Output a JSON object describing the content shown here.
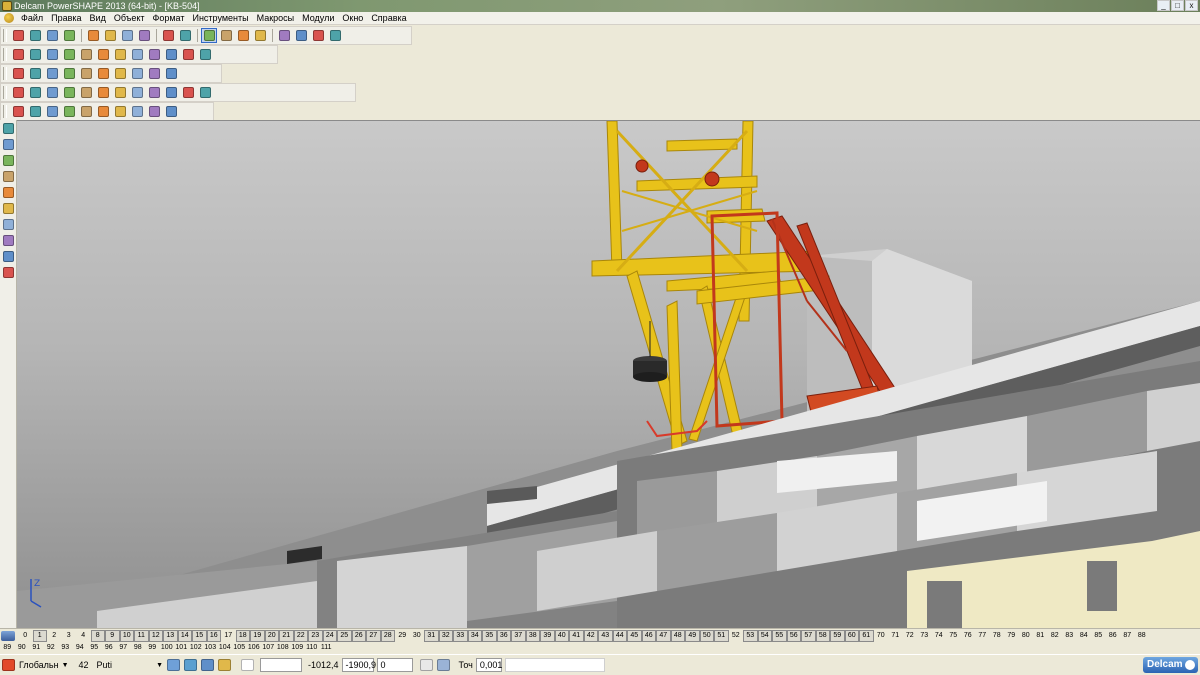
{
  "window": {
    "title": "Delcam PowerSHAPE 2013 (64-bit) - [KB-504]",
    "controls": [
      "_",
      "□",
      "x"
    ]
  },
  "menu": {
    "items": [
      "Файл",
      "Правка",
      "Вид",
      "Объект",
      "Формат",
      "Инструменты",
      "Макросы",
      "Модули",
      "Окно",
      "Справка"
    ]
  },
  "toolbars": {
    "row1_icons": [
      "new-icon",
      "open-icon",
      "save-icon",
      "print-icon",
      "separator",
      "cut-icon",
      "copy-icon",
      "paste-icon",
      "delete-icon",
      "separator",
      "undo-icon",
      "redo-icon",
      "separator",
      "select-icon",
      "circle-icon",
      "arc-icon",
      "text-icon",
      "separator",
      "solid-icon",
      "surface-icon",
      "wireframe-icon",
      "tools-icon"
    ],
    "row2_icons": [
      "view-top-icon",
      "view-front-icon",
      "view-right-icon",
      "view-iso-icon",
      "zoom-in-icon",
      "zoom-out-icon",
      "zoom-box-icon",
      "zoom-all-icon",
      "shade-icon",
      "wireframe-icon",
      "render-icon",
      "light-icon"
    ],
    "row3_icons": [
      "calculator-icon",
      "document-icon",
      "shape-icon",
      "sphere-icon",
      "red-ball-icon",
      "green-arrow-icon",
      "blue-arrow-icon",
      "box-icon",
      "cube-icon",
      "gear-icon"
    ],
    "row4_icons": [
      "solid-box-icon",
      "solid-cylinder-icon",
      "solid-cone-icon",
      "solid-sphere-icon",
      "solid-torus-icon",
      "solid-extrude-icon",
      "boolean-add-icon",
      "boolean-subtract-icon",
      "boolean-intersect-icon",
      "fillet-icon",
      "chamfer-icon",
      "shell-icon"
    ],
    "row5_icons": [
      "move-icon",
      "mirror-icon",
      "rotate-icon",
      "scale-icon",
      "offset-icon",
      "array-icon",
      "block-icon",
      "palette-icon",
      "measure-icon",
      "pen-icon"
    ],
    "left_icons": [
      "select-icon",
      "layers-icon",
      "line-icon",
      "polyline-icon",
      "rectangle-icon",
      "polygon-icon",
      "solid-icon",
      "dimension-icon",
      "curve-icon",
      "axis-icon"
    ]
  },
  "viewport": {
    "axis_label": "Z"
  },
  "levels": {
    "row1": [
      "0",
      "1",
      "2",
      "3",
      "4",
      "8",
      "9",
      "10",
      "11",
      "12",
      "13",
      "14",
      "15",
      "16",
      "17",
      "18",
      "19",
      "20",
      "21",
      "22",
      "23",
      "24",
      "25",
      "26",
      "27",
      "28",
      "29",
      "30",
      "31",
      "32",
      "33",
      "34",
      "35",
      "36",
      "37",
      "38",
      "39",
      "40",
      "41",
      "42",
      "43",
      "44",
      "45",
      "46",
      "47",
      "48",
      "49",
      "50",
      "51",
      "52",
      "53",
      "54",
      "55",
      "56",
      "57",
      "58",
      "59",
      "60",
      "61",
      "70",
      "71",
      "72",
      "73",
      "74",
      "75",
      "76",
      "77",
      "78",
      "79",
      "80",
      "81",
      "82",
      "83",
      "84",
      "85",
      "86",
      "87",
      "88"
    ],
    "row1_on": [
      "1",
      "8",
      "9",
      "10",
      "11",
      "12",
      "13",
      "14",
      "15",
      "16",
      "18",
      "19",
      "20",
      "21",
      "22",
      "23",
      "24",
      "25",
      "26",
      "27",
      "28",
      "31",
      "32",
      "33",
      "34",
      "35",
      "36",
      "37",
      "38",
      "39",
      "40",
      "41",
      "42",
      "43",
      "44",
      "45",
      "46",
      "47",
      "48",
      "49",
      "50",
      "51",
      "53",
      "54",
      "55",
      "56",
      "57",
      "58",
      "59",
      "60",
      "61"
    ],
    "row2": [
      "89",
      "90",
      "91",
      "92",
      "93",
      "94",
      "95",
      "96",
      "97",
      "98",
      "99",
      "100",
      "101",
      "102",
      "103",
      "104",
      "105",
      "106",
      "107",
      "108",
      "109",
      "110",
      "111"
    ]
  },
  "status": {
    "workplane": "Глобальн",
    "level_number": "42",
    "level_name": "Puti",
    "x": "-1012,4",
    "y": "-1900,9",
    "z": "0",
    "tolerance_label": "Точ",
    "tolerance": "0,001",
    "brand": "Delcam"
  },
  "colors": {
    "crane_yellow": "#e8c21a",
    "crane_red": "#c2381c",
    "wall_gray": "#9a9a9a",
    "wall_light": "#e6e6e6",
    "facade_cream": "#efe9c4",
    "selection_blue": "#3169c6"
  }
}
